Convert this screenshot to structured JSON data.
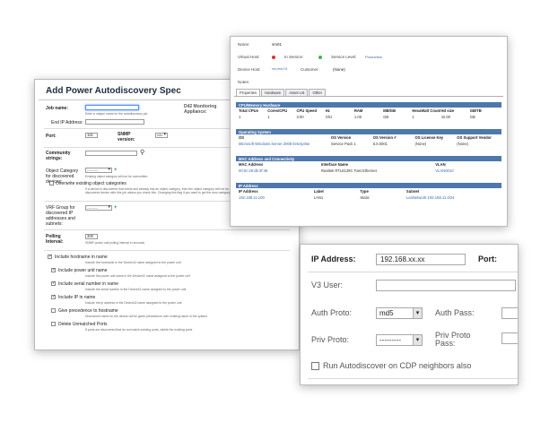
{
  "spec_form": {
    "title": "Add Power Autodiscovery Spec",
    "job_name_label": "Job name:",
    "job_name_hint": "Enter a unique name for the autodiscovery job",
    "d42_label": "D42 Monitoring Appliance:",
    "end_ip_label": "End IP Address:",
    "port_label": "Port:",
    "port_value": "161",
    "snmp_label": "SNMP version:",
    "snmp_value": "v2c",
    "community_label": "Community strings:",
    "object_category_label": "Object Category for discovered devices:",
    "object_category_value": "---------",
    "object_category_hint": "Existing object category will not be overwritten.",
    "overwrite_label": "Overwrite existing object categories",
    "overwrite_hint": "If a device is discovered that exists and already has an object category, then the object category will not be overwritten by the discovered device with this job unless you check this. Changing this flag if you want to get the new category.",
    "vrf_label": "VRF Group for discovered IP addresses and subnets:",
    "vrf_value": "---------",
    "polling_label": "Polling Interval:",
    "polling_value": "300",
    "polling_hint": "SNMP power unit polling interval in seconds",
    "options": [
      {
        "label": "Include hostname in name",
        "checked": true,
        "hint": "Include the hostname in the Device42 name assigned to the power unit"
      },
      {
        "label": "Include power unit name",
        "checked": true,
        "hint": "Include the power unit name in the Device42 name assigned to the power unit"
      },
      {
        "label": "Include serial number in name",
        "checked": true,
        "hint": "Include the serial number in the Device42 name assigned to the power unit"
      },
      {
        "label": "Include IP in name",
        "checked": true,
        "hint": "Include the ip address in the Device42 name assigned to the power unit"
      },
      {
        "label": "Give precedence to hostname",
        "checked": false,
        "hint": "Discovered name for the device will be given precedence over existing name in the system"
      },
      {
        "label": "Delete Unmatched Ports",
        "checked": false,
        "hint": "If ports are discovered that do not match existing ports, delete the existing ports"
      }
    ]
  },
  "device_panel": {
    "name_label": "Name:",
    "name_value": "sm01",
    "virtual_host_label": "Virtual Host:",
    "in_service_label": "In Service:",
    "service_level_label": "Service Level:",
    "service_level_value": "Production",
    "device_host_label": "Device Host:",
    "device_host_value": "sm-esxi-01",
    "customer_label": "Customer:",
    "customer_value": "(None)",
    "notes_label": "Notes:",
    "colors": {
      "red": "#d9322c",
      "green": "#3db54a"
    },
    "tabs": [
      "Properties",
      "Hardware",
      "Asset Lst",
      "Other"
    ],
    "cpu": {
      "header": "CPU/Memory Hardware",
      "columns": [
        "Total CPUs",
        "Cores/CPU",
        "CPU Speed",
        "Hz",
        "RAM",
        "MB/GB",
        "HexaWatt Count",
        "Hd size",
        "GB/TB"
      ],
      "values": [
        "1",
        "1",
        "3.00",
        "Ghz",
        "1.00",
        "GB",
        "1",
        "42.00",
        "GB"
      ]
    },
    "os": {
      "header": "Operating System",
      "columns": [
        "OS",
        "OS Version",
        "OS Version #",
        "OS License Key",
        "OS Support Vendor"
      ],
      "values": [
        "Microsoft Windows Server 2008 Enterprise",
        "Service Pack 1",
        "6.0.6001",
        "(None)",
        "(None)"
      ]
    },
    "mac": {
      "header": "MAC Address and Connectivity",
      "columns": [
        "MAC Address",
        "Interface Name",
        "VLAN"
      ],
      "values": [
        "00:0c:29:db:3f:45",
        "Realtek RTL8139C Fast Ethernet",
        "VLAN0010"
      ]
    },
    "ip": {
      "header": "IP Address",
      "columns": [
        "IP Address",
        "Label",
        "Type",
        "Subnet"
      ],
      "values": [
        "192.168.11.100",
        "LAN1",
        "Static",
        "LanNetwork-192.168.11.0/24"
      ]
    }
  },
  "ip_panel": {
    "ip_label": "IP Address:",
    "ip_value": "192.168.xx.xx",
    "port_label": "Port:",
    "v3user_label": "V3 User:",
    "auth_proto_label": "Auth Proto:",
    "auth_proto_value": "md5",
    "auth_pass_label": "Auth Pass:",
    "priv_proto_label": "Priv Proto:",
    "priv_proto_value": "---------",
    "priv_proto_pass_label": "Priv Proto Pass:",
    "cdp_label": "Run Autodiscover on CDP neighbors also"
  }
}
